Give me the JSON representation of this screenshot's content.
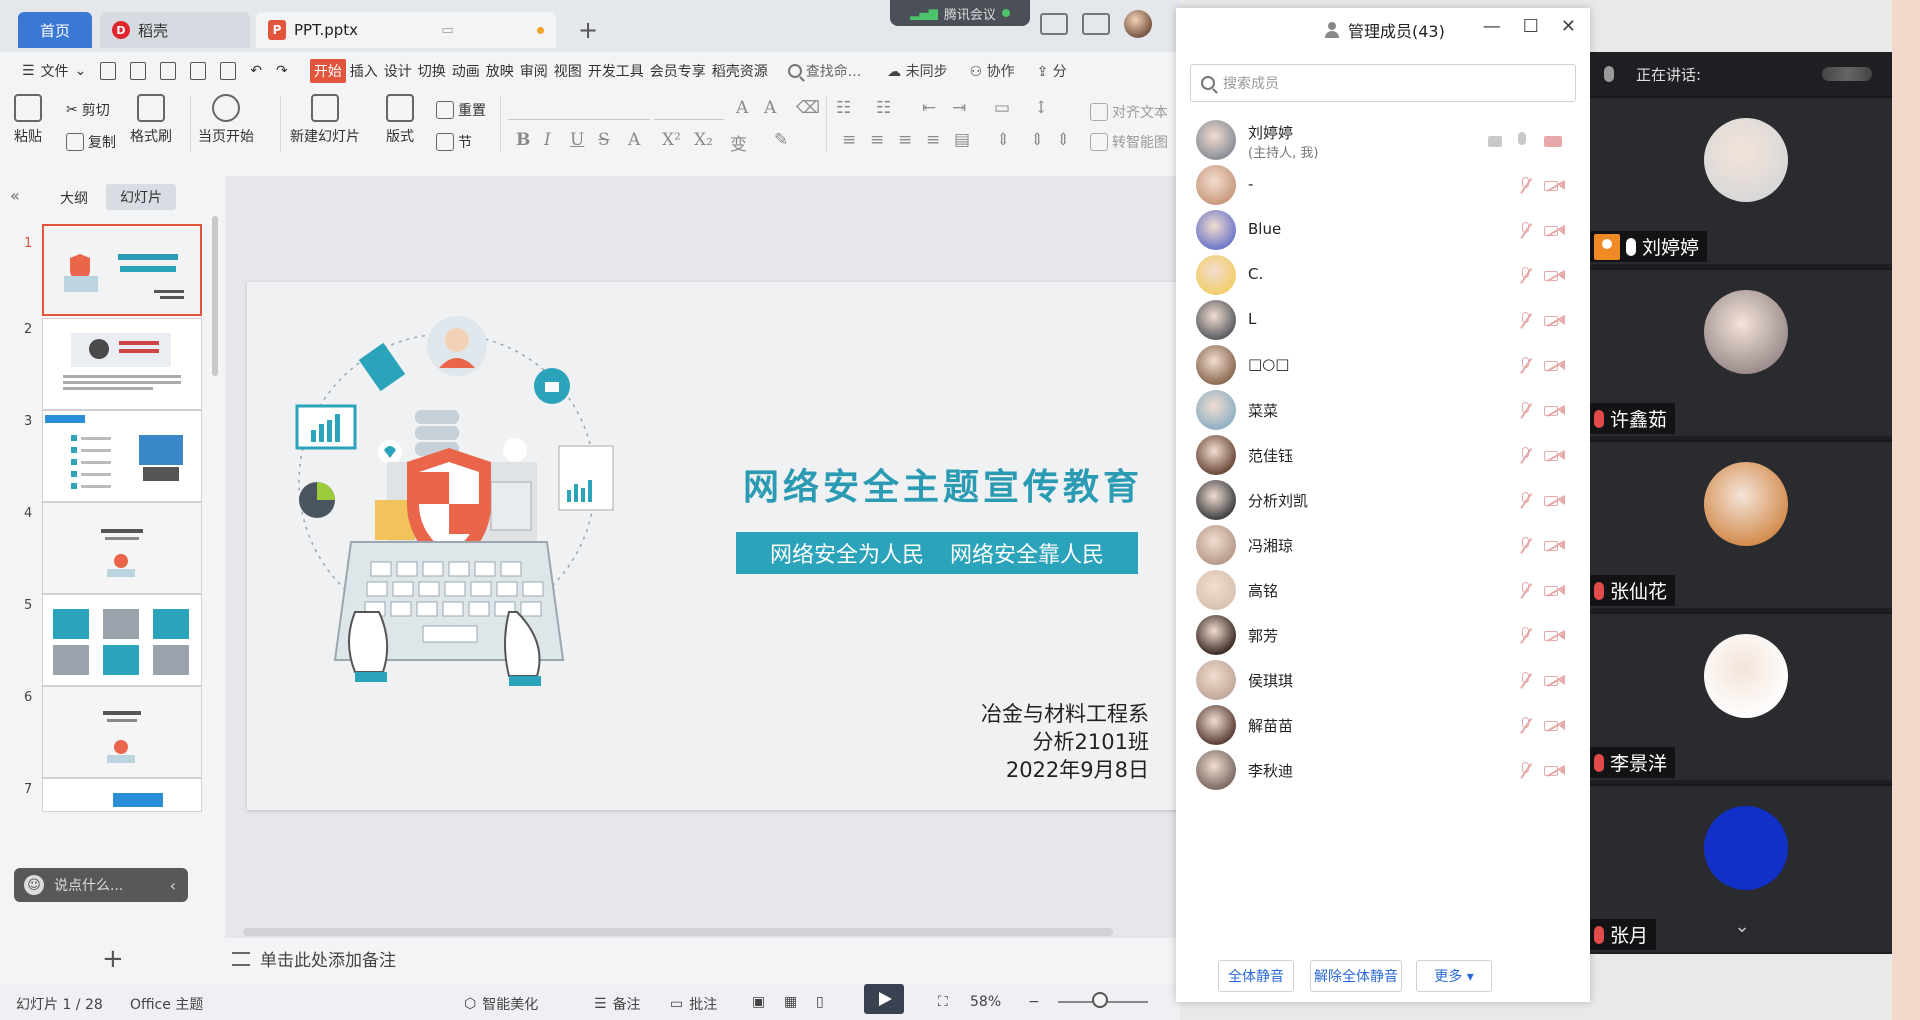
{
  "tabs": {
    "home": "首页",
    "docer": "稻壳",
    "doc": "PPT.pptx",
    "add": "+"
  },
  "tencent": {
    "label": "腾讯会议"
  },
  "menu": {
    "file": "文件",
    "start": "开始",
    "items": [
      "插入",
      "设计",
      "切换",
      "动画",
      "放映",
      "审阅",
      "视图",
      "开发工具",
      "会员专享",
      "稻壳资源"
    ],
    "search": "查找命...",
    "sync": "未同步",
    "collab": "协作",
    "share": "分"
  },
  "ribbon": {
    "paste": "粘贴",
    "cut": "剪切",
    "copy": "复制",
    "format_painter": "格式刷",
    "from_current": "当页开始",
    "new_slide": "新建幻灯片",
    "layout": "版式",
    "reset": "重置",
    "section": "节",
    "align_text": "对齐文本",
    "smart_graphic": "转智能图"
  },
  "left_panel": {
    "collapse": "«",
    "outline": "大纲",
    "slides": "幻灯片",
    "thumb_numbers": [
      "1",
      "2",
      "3",
      "4",
      "5",
      "6",
      "7"
    ],
    "chat_placeholder": "说点什么...",
    "add_slide": "+"
  },
  "slide": {
    "title": "网络安全主题宣传教育",
    "band_left": "网络安全为人民",
    "band_right": "网络安全靠人民",
    "dept": "冶金与材料工程系",
    "class": "分析2101班",
    "date": "2022年9月8日"
  },
  "notes": {
    "placeholder": "单击此处添加备注"
  },
  "status": {
    "slide_count": "幻灯片 1 / 28",
    "theme": "Office 主题",
    "beautify": "智能美化",
    "notes": "备注",
    "comment": "批注",
    "zoom": "58%"
  },
  "members": {
    "title": "管理成员(43)",
    "search_placeholder": "搜索成员",
    "list": [
      {
        "name": "刘婷婷",
        "sub": "(主持人, 我)",
        "host": true,
        "color": "#8a8f98"
      },
      {
        "name": "-",
        "sub": "",
        "host": false,
        "color": "#c99a7e"
      },
      {
        "name": "Blue",
        "sub": "",
        "host": false,
        "color": "#6e78c8"
      },
      {
        "name": "C.",
        "sub": "",
        "host": false,
        "color": "#f2cf6a"
      },
      {
        "name": "L",
        "sub": "",
        "host": false,
        "color": "#5a5d62"
      },
      {
        "name": "□○□",
        "sub": "",
        "host": false,
        "color": "#8a6a52"
      },
      {
        "name": "菜菜",
        "sub": "",
        "host": false,
        "color": "#8fb0c4"
      },
      {
        "name": "范佳钰",
        "sub": "",
        "host": false,
        "color": "#6b4a3a"
      },
      {
        "name": "分析刘凯",
        "sub": "",
        "host": false,
        "color": "#3e4044"
      },
      {
        "name": "冯湘琼",
        "sub": "",
        "host": false,
        "color": "#b59a8a"
      },
      {
        "name": "高铭",
        "sub": "",
        "host": false,
        "color": "#d9c2b0"
      },
      {
        "name": "郭芳",
        "sub": "",
        "host": false,
        "color": "#3b2a24"
      },
      {
        "name": "侯琪琪",
        "sub": "",
        "host": false,
        "color": "#c2a898"
      },
      {
        "name": "解苗苗",
        "sub": "",
        "host": false,
        "color": "#5a3f36"
      },
      {
        "name": "李秋迪",
        "sub": "",
        "host": false,
        "color": "#7a6a62"
      }
    ],
    "mute_all": "全体静音",
    "unmute_all": "解除全体静音",
    "more": "更多 ▾"
  },
  "video": {
    "speaking": "正在讲话:",
    "tiles": [
      {
        "name": "刘婷婷",
        "host": true,
        "color": "#d8d8d8"
      },
      {
        "name": "许鑫茹",
        "host": false,
        "color": "#9a8a8a"
      },
      {
        "name": "张仙花",
        "host": false,
        "color": "#d28a4a"
      },
      {
        "name": "李景洋",
        "host": false,
        "color": "#ffffff"
      },
      {
        "name": "张月",
        "host": false,
        "color": "#1030c8"
      }
    ],
    "expand": "⌄"
  }
}
